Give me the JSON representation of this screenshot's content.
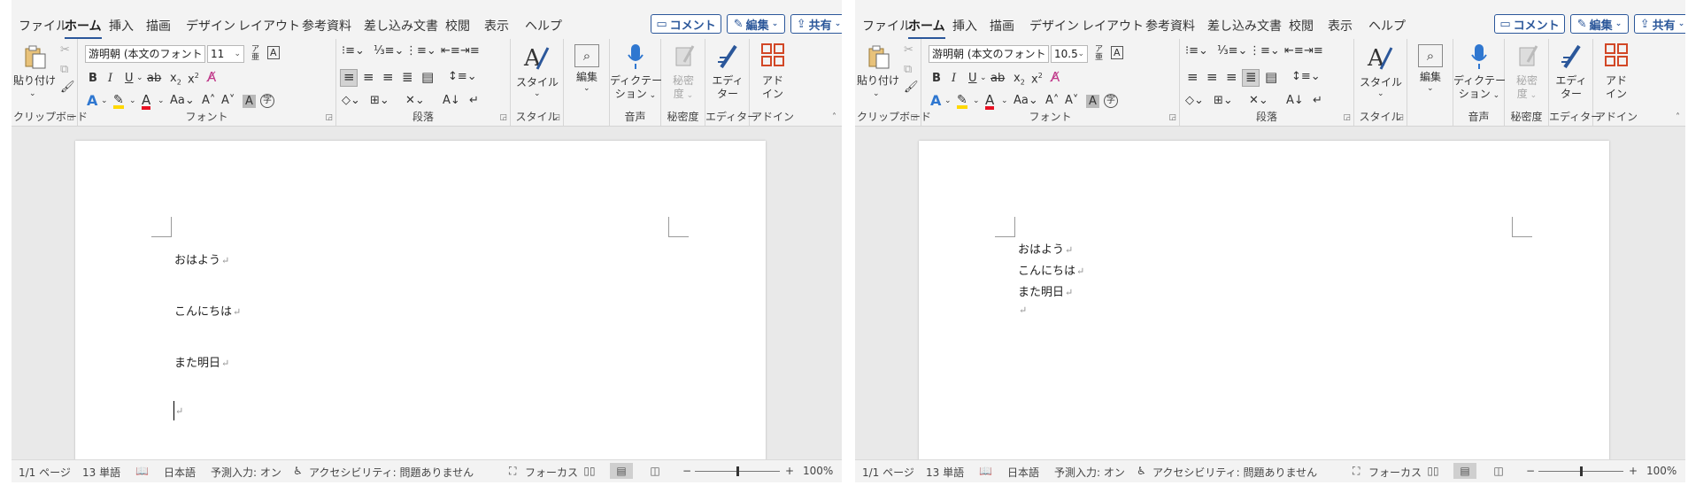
{
  "panes": [
    {
      "id": "left",
      "menu": {
        "tabs": [
          "ファイル",
          "ホーム",
          "挿入",
          "描画",
          "デザイン",
          "レイアウト",
          "参考資料",
          "差し込み文書",
          "校閲",
          "表示",
          "ヘルプ"
        ],
        "active_tab": "ホーム",
        "comment_button": "コメント",
        "edit_button": "編集",
        "share_button": "共有"
      },
      "ribbon": {
        "clipboard": {
          "paste_label": "貼り付け",
          "group_label": "クリップボード"
        },
        "font": {
          "font_name": "游明朝 (本文のフォント - 日本",
          "font_size": "11",
          "group_label": "フォント"
        },
        "paragraph": {
          "group_label": "段落"
        },
        "styles": {
          "label": "スタイル",
          "group_label": "スタイル"
        },
        "editing": {
          "label": "編集"
        },
        "voice": {
          "label_line1": "ディクテー",
          "label_line2": "ション",
          "group_label": "音声"
        },
        "sensitivity": {
          "label_line1": "秘密",
          "label_line2": "度",
          "group_label": "秘密度"
        },
        "editor": {
          "label_line1": "エディ",
          "label_line2": "ター",
          "group_label": "エディター"
        },
        "addins": {
          "label_line1": "アド",
          "label_line2": "イン",
          "group_label": "アドイン"
        }
      },
      "document": {
        "lines": [
          "おはよう",
          "こんにちは",
          "また明日",
          ""
        ],
        "paragraph_mark": "↵"
      },
      "status_bar": {
        "page": "1/1 ページ",
        "words": "13 単語",
        "language": "日本語",
        "predictive": "予測入力: オン",
        "accessibility": "アクセシビリティ: 問題ありません",
        "focus": "フォーカス",
        "zoom": "100%"
      }
    },
    {
      "id": "right",
      "menu": {
        "tabs": [
          "ファイル",
          "ホーム",
          "挿入",
          "描画",
          "デザイン",
          "レイアウト",
          "参考資料",
          "差し込み文書",
          "校閲",
          "表示",
          "ヘルプ"
        ],
        "active_tab": "ホーム",
        "comment_button": "コメント",
        "edit_button": "編集",
        "share_button": "共有"
      },
      "ribbon": {
        "clipboard": {
          "paste_label": "貼り付け",
          "group_label": "クリップボード"
        },
        "font": {
          "font_name": "游明朝 (本文のフォント - 日本",
          "font_size": "10.5",
          "group_label": "フォント"
        },
        "paragraph": {
          "group_label": "段落"
        },
        "styles": {
          "label": "スタイル",
          "group_label": "スタイル"
        },
        "editing": {
          "label": "編集"
        },
        "voice": {
          "label_line1": "ディクテー",
          "label_line2": "ション",
          "group_label": "音声"
        },
        "sensitivity": {
          "label_line1": "秘密",
          "label_line2": "度",
          "group_label": "秘密度"
        },
        "editor": {
          "label_line1": "エディ",
          "label_line2": "ター",
          "group_label": "エディター"
        },
        "addins": {
          "label_line1": "アド",
          "label_line2": "イン",
          "group_label": "アドイン"
        }
      },
      "document": {
        "lines": [
          "おはよう",
          "こんにちは",
          "また明日",
          ""
        ],
        "paragraph_mark": "↵"
      },
      "status_bar": {
        "page": "1/1 ページ",
        "words": "13 単語",
        "language": "日本語",
        "predictive": "予測入力: オン",
        "accessibility": "アクセシビリティ: 問題ありません",
        "focus": "フォーカス",
        "zoom": "100%"
      }
    }
  ],
  "icons": {
    "comment": "comment-icon",
    "edit": "pencil-icon",
    "share": "share-icon"
  },
  "colors": {
    "accent": "#2b579a",
    "ribbon_bg": "#f3f3f3",
    "canvas_bg": "#e9e9e9",
    "font_color_red": "#e81123",
    "highlight_yellow": "#ffd800",
    "text_effect_blue": "#2f77d0",
    "addin_orange": "#d24726"
  }
}
